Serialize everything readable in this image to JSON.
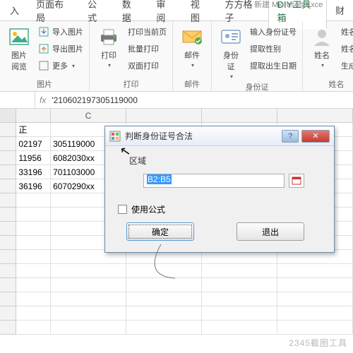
{
  "app": {
    "title": "新建 Microsoft Exce"
  },
  "tabs": {
    "t0": "入",
    "page_layout": "页面布局",
    "formulas": "公式",
    "data": "数据",
    "review": "审阅",
    "view": "视图",
    "fanggezi": "方方格子",
    "diy": "DIY工具箱",
    "fin": "财"
  },
  "ribbon": {
    "g1_label": "图片",
    "g1": {
      "view": "图片\n阅览",
      "import": "导入图片",
      "export": "导出图片",
      "more": "更多"
    },
    "g2_label": "打印",
    "g2": {
      "print": "打印",
      "cur": "打印当前页",
      "batch": "批量打印",
      "dup": "双面打印"
    },
    "g3_label": "邮件",
    "g3": {
      "mail": "邮件"
    },
    "g4_label": "身份证",
    "g4": {
      "idcard": "身份\n证",
      "input": "输入身份证号",
      "gender": "提取性别",
      "birth": "提取出生日期"
    },
    "g5_label": "姓名",
    "g5": {
      "name": "姓名",
      "split": "姓名分",
      "add": "姓名加",
      "rand": "生成随"
    }
  },
  "formula_bar": {
    "fx": "fx",
    "value": "'210602197305119000"
  },
  "grid": {
    "col_c": "C",
    "rows": [
      {
        "b": "正"
      },
      {
        "b": "02197",
        "c": "305119000"
      },
      {
        "b": "11956",
        "c": "6082030xx"
      },
      {
        "b": "33196",
        "c": "701103000"
      },
      {
        "b": "36196",
        "c": "6070290xx"
      }
    ]
  },
  "dialog": {
    "title": "判断身份证号合法",
    "region_label": "区域",
    "range_value": "B2:B5",
    "use_formula": "使用公式",
    "ok": "确定",
    "exit": "退出",
    "help": "?",
    "close": "✕"
  },
  "watermark": "2345截图工具"
}
